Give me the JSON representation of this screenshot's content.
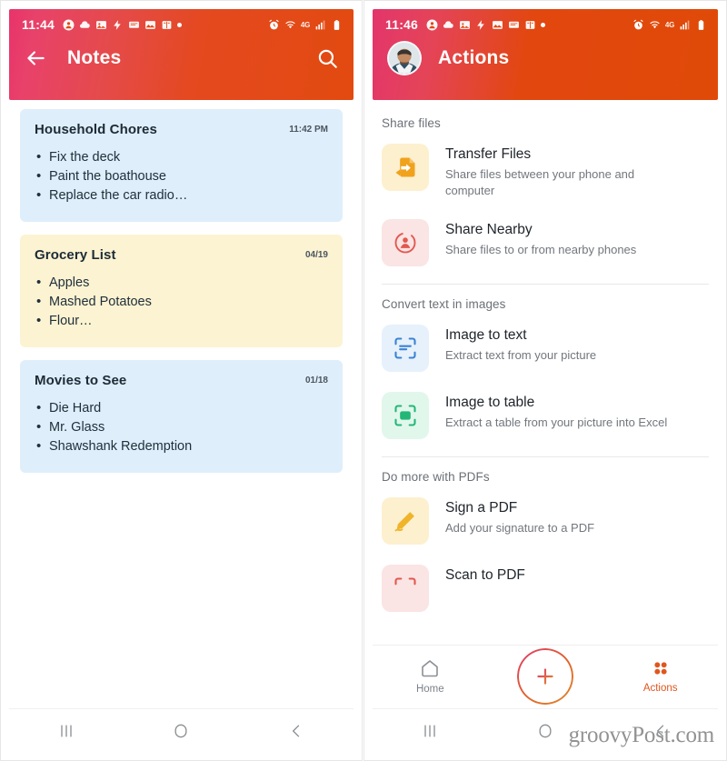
{
  "left_phone": {
    "status_bar": {
      "time": "11:44",
      "icons": [
        "contact-icon",
        "cloud-icon",
        "photo-icon",
        "flash-icon",
        "message-icon",
        "gallery-icon",
        "book-icon",
        "dot-icon"
      ],
      "right_icons": [
        "alarm-icon",
        "wifi-icon",
        "lte-icon",
        "signal-icon",
        "battery-icon"
      ],
      "network_label": "4G"
    },
    "appbar": {
      "back_icon": "arrow-left-icon",
      "title": "Notes",
      "search_icon": "search-icon"
    },
    "notes": [
      {
        "title": "Household Chores",
        "date": "11:42 PM",
        "color": "blue",
        "items": [
          "Fix the deck",
          "Paint the boathouse",
          "Replace the car radio…"
        ]
      },
      {
        "title": "Grocery List",
        "date": "04/19",
        "color": "yellow",
        "items": [
          "Apples",
          "Mashed Potatoes",
          "Flour…"
        ]
      },
      {
        "title": "Movies to See",
        "date": "01/18",
        "color": "blue",
        "items": [
          "Die Hard",
          "Mr. Glass",
          "Shawshank Redemption"
        ]
      }
    ],
    "android_nav": [
      "recents-button",
      "home-button",
      "back-button"
    ]
  },
  "right_phone": {
    "status_bar": {
      "time": "11:46",
      "icons": [
        "contact-icon",
        "cloud-icon",
        "photo-icon",
        "flash-icon",
        "gallery-icon",
        "message-icon",
        "book-icon",
        "dot-icon"
      ],
      "right_icons": [
        "alarm-icon",
        "wifi-icon",
        "lte-icon",
        "signal-icon",
        "battery-icon"
      ],
      "network_label": "4G"
    },
    "appbar": {
      "avatar": "user-avatar",
      "title": "Actions"
    },
    "sections": [
      {
        "label": "Share files",
        "rows": [
          {
            "title": "Transfer Files",
            "desc": "Share files between your phone and computer",
            "icon": "file-transfer-icon",
            "icon_style": "ai-amber"
          },
          {
            "title": "Share Nearby",
            "desc": "Share files to or from nearby phones",
            "icon": "share-nearby-icon",
            "icon_style": "ai-pink"
          }
        ]
      },
      {
        "label": "Convert text in images",
        "rows": [
          {
            "title": "Image to text",
            "desc": "Extract text from your picture",
            "icon": "scan-text-icon",
            "icon_style": "ai-blue"
          },
          {
            "title": "Image to table",
            "desc": "Extract a table from your picture into Excel",
            "icon": "scan-table-icon",
            "icon_style": "ai-green"
          }
        ]
      },
      {
        "label": "Do more with PDFs",
        "rows": [
          {
            "title": "Sign a PDF",
            "desc": "Add your signature to a PDF",
            "icon": "pen-icon",
            "icon_style": "ai-amber"
          },
          {
            "title": "Scan to PDF",
            "desc": "",
            "icon": "scan-pdf-icon",
            "icon_style": "ai-pink"
          }
        ]
      }
    ],
    "bottom_nav": {
      "home_label": "Home",
      "home_icon": "home-icon",
      "fab_icon": "plus-icon",
      "actions_label": "Actions",
      "actions_icon": "grid-dots-icon",
      "active_tab": "Actions"
    },
    "android_nav": [
      "recents-button",
      "home-button",
      "back-button"
    ]
  },
  "watermark": "groovyPost.com",
  "colors": {
    "header_pink": "#e3356c",
    "header_orange": "#e04a08",
    "accent": "#e0561f",
    "note_blue": "#dfeefb",
    "note_yellow": "#fcf3d2"
  }
}
